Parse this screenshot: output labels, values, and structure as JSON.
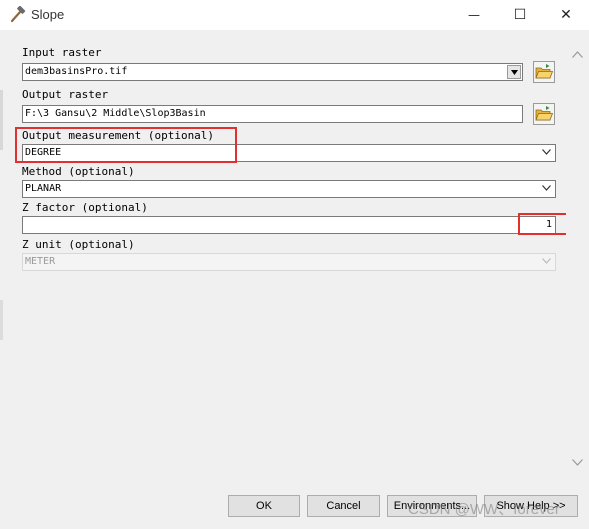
{
  "window": {
    "title": "Slope",
    "minimize_symbol": "—",
    "maximize_symbol": "☐",
    "close_symbol": "✕",
    "title_icon": "hammer-icon"
  },
  "form": {
    "input_raster": {
      "label": "Input raster",
      "value": "dem3basinsPro.tif"
    },
    "output_raster": {
      "label": "Output raster",
      "value": "F:\\3 Gansu\\2 Middle\\Slop3Basin"
    },
    "output_measurement": {
      "label": "Output measurement (optional)",
      "value": "DEGREE"
    },
    "method": {
      "label": "Method (optional)",
      "value": "PLANAR"
    },
    "z_factor": {
      "label": "Z factor (optional)",
      "value": "1"
    },
    "z_unit": {
      "label": "Z unit (optional)",
      "value": "METER"
    }
  },
  "buttons": {
    "ok": "OK",
    "cancel": "Cancel",
    "environments": "Environments...",
    "show_help": "Show Help >>"
  },
  "watermark": "CSDN @WW、forever",
  "colors": {
    "highlight_box": "#e03030",
    "panel_bg": "#f0f0f0",
    "folder_icon": "#f2c14e"
  }
}
